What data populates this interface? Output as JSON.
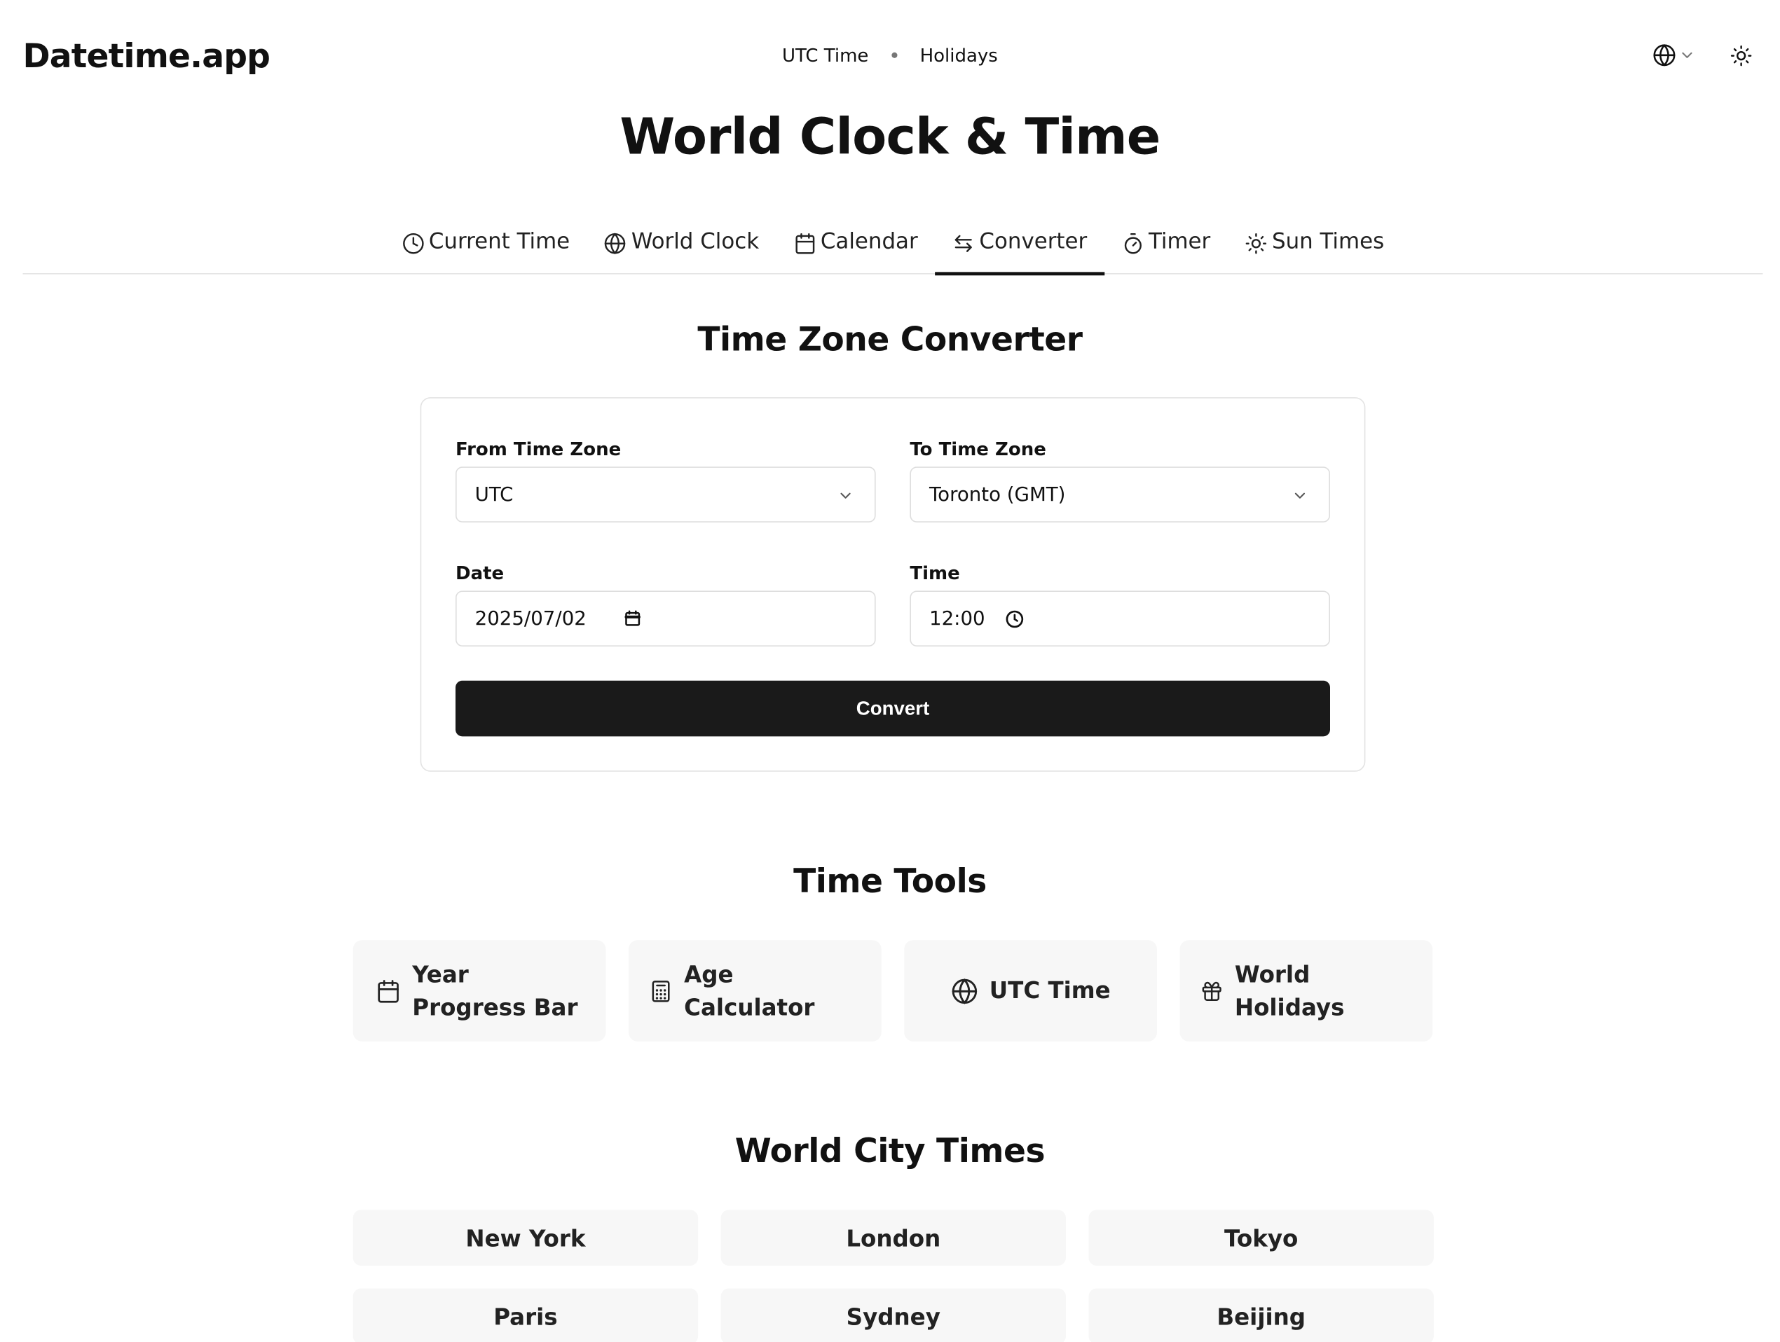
{
  "header": {
    "logo": "Datetime.app",
    "nav": [
      "UTC Time",
      "Holidays"
    ],
    "language_icon": "globe-icon",
    "theme_icon": "sun-icon"
  },
  "main_title": "World Clock & Time",
  "tabs": [
    {
      "label": "Current Time",
      "icon": "clock-icon",
      "active": false
    },
    {
      "label": "World Clock",
      "icon": "globe-icon",
      "active": false
    },
    {
      "label": "Calendar",
      "icon": "calendar-icon",
      "active": false
    },
    {
      "label": "Converter",
      "icon": "arrows-swap-icon",
      "active": true
    },
    {
      "label": "Timer",
      "icon": "stopwatch-icon",
      "active": false
    },
    {
      "label": "Sun Times",
      "icon": "sun-icon",
      "active": false
    }
  ],
  "converter": {
    "title": "Time Zone Converter",
    "from_label": "From Time Zone",
    "from_value": "UTC",
    "to_label": "To Time Zone",
    "to_value": "Toronto (GMT)",
    "date_label": "Date",
    "date_value": "2025/07/02",
    "time_label": "Time",
    "time_value": "12:00",
    "button_label": "Convert"
  },
  "tools": {
    "title": "Time Tools",
    "items": [
      {
        "label": "Year Progress Bar",
        "icon": "calendar-icon"
      },
      {
        "label": "Age Calculator",
        "icon": "calculator-icon"
      },
      {
        "label": "UTC Time",
        "icon": "globe-icon"
      },
      {
        "label": "World Holidays",
        "icon": "gift-icon"
      }
    ]
  },
  "cities": {
    "title": "World City Times",
    "items": [
      "New York",
      "London",
      "Tokyo",
      "Paris",
      "Sydney",
      "Beijing"
    ]
  },
  "colors": {
    "text": "#111111",
    "button_bg": "#1a1a1a",
    "card_bg": "#f7f7f7",
    "border": "#e3e3e3"
  }
}
